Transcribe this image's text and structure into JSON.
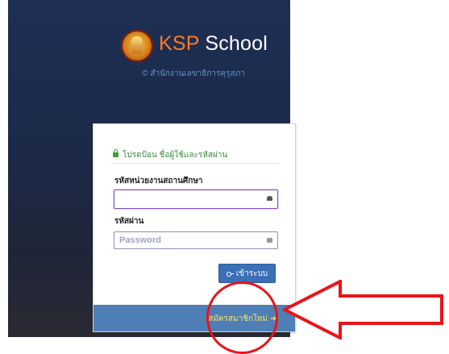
{
  "header": {
    "brand_ksp": "KSP",
    "brand_school": " School",
    "copyright": "© สำนักงานเลขาธิการคุรุสภา"
  },
  "login": {
    "notice": "โปรดป้อน ชื่อผู้ใช้และรหัสผ่าน",
    "username_label": "รหัสหน่วยงานสถานศึกษา",
    "username_value": "",
    "password_label": "รหัสผ่าน",
    "password_placeholder": "Password",
    "login_button": "เข้าระบบ",
    "register_link": "สมัครสมาชิกใหม่"
  },
  "annotation": {
    "color": "#e8141a"
  },
  "icons": [
    "logo-emblem",
    "lock-icon",
    "user-icon",
    "key-icon",
    "arrow-right-icon"
  ]
}
